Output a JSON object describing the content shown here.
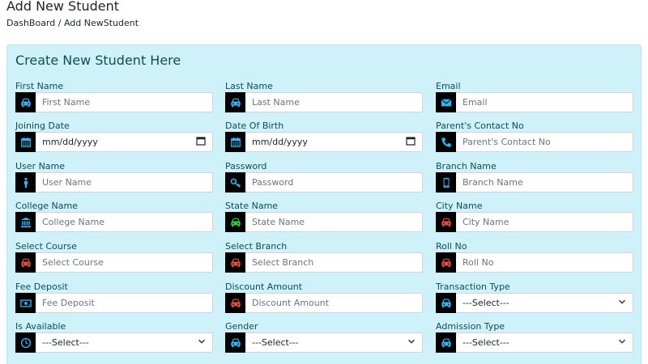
{
  "header": {
    "title": "Add New Student",
    "breadcrumb": "DashBoard / Add NewStudent"
  },
  "form": {
    "title": "Create New Student Here",
    "fields": {
      "first_name": {
        "label": "First Name",
        "placeholder": "First Name",
        "icon": "car-icon",
        "color": "#29b6f6"
      },
      "last_name": {
        "label": "Last Name",
        "placeholder": "Last Name",
        "icon": "car-icon",
        "color": "#29b6f6"
      },
      "email": {
        "label": "Email",
        "placeholder": "Email",
        "icon": "envelope-icon",
        "color": "#29b6f6"
      },
      "joining_date": {
        "label": "Joining Date",
        "value": "mm/dd/yyyy",
        "icon": "calendar-icon",
        "color": "#29b6f6"
      },
      "dob": {
        "label": "Date Of Birth",
        "value": "mm/dd/yyyy",
        "icon": "calendar-icon",
        "color": "#29b6f6"
      },
      "parent_contact": {
        "label": "Parent's Contact No",
        "placeholder": "Parent's Contact No",
        "icon": "phone-icon",
        "color": "#29b6f6"
      },
      "user_name": {
        "label": "User Name",
        "placeholder": "User Name",
        "icon": "person-icon",
        "color": "#29b6f6"
      },
      "password": {
        "label": "Password",
        "placeholder": "Password",
        "icon": "key-icon",
        "color": "#29b6f6"
      },
      "branch_name": {
        "label": "Branch Name",
        "placeholder": "Branch Name",
        "icon": "mobile-icon",
        "color": "#29b6f6"
      },
      "college_name": {
        "label": "College Name",
        "placeholder": "College Name",
        "icon": "bank-icon",
        "color": "#29b6f6"
      },
      "state_name": {
        "label": "State Name",
        "placeholder": "State Name",
        "icon": "car-icon",
        "color": "#2ecc40"
      },
      "city_name": {
        "label": "City Name",
        "placeholder": "City Name",
        "icon": "car-icon",
        "color": "#e74c3c"
      },
      "select_course": {
        "label": "Select Course",
        "placeholder": "Select Course",
        "icon": "car-icon",
        "color": "#e74c3c"
      },
      "select_branch": {
        "label": "Select Branch",
        "placeholder": "Select Branch",
        "icon": "car-icon",
        "color": "#e74c3c"
      },
      "roll_no": {
        "label": "Roll No",
        "placeholder": "Roll No",
        "icon": "car-icon",
        "color": "#e74c3c"
      },
      "fee_deposit": {
        "label": "Fee Deposit",
        "placeholder": "Fee Deposit",
        "icon": "money-icon",
        "color": "#29b6f6"
      },
      "discount_amount": {
        "label": "Discount Amount",
        "placeholder": "Discount Amount",
        "icon": "car-icon",
        "color": "#e74c3c"
      },
      "transaction_type": {
        "label": "Transaction Type",
        "selected": "---Select---",
        "icon": "car-icon",
        "color": "#29b6f6"
      },
      "is_available": {
        "label": "Is Available",
        "selected": "---Select---",
        "icon": "clock-icon",
        "color": "#29b6f6"
      },
      "gender": {
        "label": "Gender",
        "selected": "---Select---",
        "icon": "car-icon",
        "color": "#29b6f6"
      },
      "admission_type": {
        "label": "Admission Type",
        "selected": "---Select---",
        "icon": "car-icon",
        "color": "#29b6f6"
      }
    }
  }
}
